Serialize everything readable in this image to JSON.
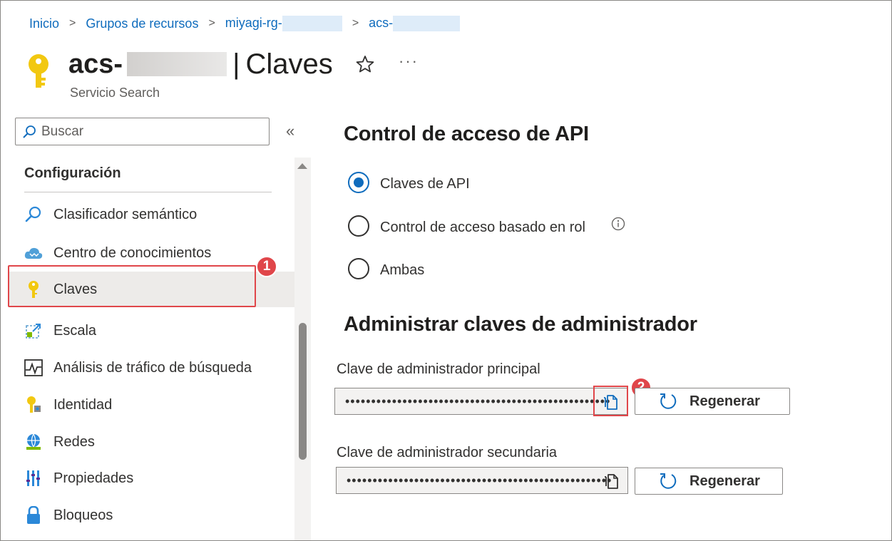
{
  "breadcrumb": {
    "items": [
      "Inicio",
      "Grupos de recursos",
      "miyagi-rg-",
      "acs-"
    ],
    "separator": ">"
  },
  "header": {
    "resource_name": "acs-",
    "pipe": "|",
    "page_title": "Claves",
    "subtitle": "Servicio Search",
    "more": "···"
  },
  "sidebar": {
    "search_placeholder": "Buscar",
    "collapse": "«",
    "section": "Configuración",
    "items": [
      {
        "label": "Clasificador semántico",
        "icon": "search-icon"
      },
      {
        "label": "Centro de conocimientos",
        "icon": "cloud-icon"
      },
      {
        "label": "Claves",
        "icon": "key-icon",
        "selected": true
      },
      {
        "label": "Escala",
        "icon": "scale-icon"
      },
      {
        "label": "Análisis de tráfico de búsqueda",
        "icon": "analytics-icon"
      },
      {
        "label": "Identidad",
        "icon": "identity-icon"
      },
      {
        "label": "Redes",
        "icon": "network-icon"
      },
      {
        "label": "Propiedades",
        "icon": "properties-icon"
      },
      {
        "label": "Bloqueos",
        "icon": "lock-icon"
      }
    ]
  },
  "annotations": {
    "step1": "1",
    "step2": "2"
  },
  "main": {
    "access_title": "Control de acceso de API",
    "options": [
      {
        "label": "Claves de API",
        "checked": true
      },
      {
        "label": "Control de acceso basado en rol",
        "checked": false
      },
      {
        "label": "Ambas",
        "checked": false
      }
    ],
    "admin_title": "Administrar claves de administrador",
    "primary_label": "Clave de administrador principal",
    "primary_value": "•••••••••••••••••••••••••••••••••••••••••••••••••••",
    "secondary_label": "Clave de administrador secundaria",
    "secondary_value": "•••••••••••••••••••••••••••••••••••••••••••••••••••",
    "regenerate_label": "Regenerar"
  },
  "colors": {
    "accent": "#0f6cbd",
    "highlight": "#e0464a",
    "key_yellow": "#f2c811"
  }
}
